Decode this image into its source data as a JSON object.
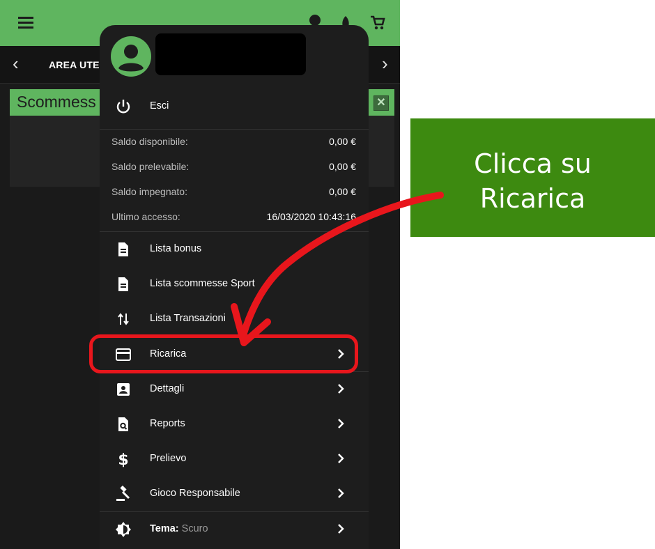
{
  "app": {
    "area_tab": "AREA UTE",
    "panel_title": "Scommess",
    "panel_close": "✕"
  },
  "menu": {
    "logout_label": "Esci",
    "balances": [
      {
        "label": "Saldo disponibile:",
        "value": "0,00 €"
      },
      {
        "label": "Saldo prelevabile:",
        "value": "0,00 €"
      },
      {
        "label": "Saldo impegnato:",
        "value": "0,00 €"
      },
      {
        "label": "Ultimo accesso:",
        "value": "16/03/2020 10:43:16"
      }
    ],
    "items": [
      {
        "label": "Lista bonus",
        "icon": "document-icon"
      },
      {
        "label": "Lista scommesse Sport",
        "icon": "document-icon"
      },
      {
        "label": "Lista Transazioni",
        "icon": "swap-vertical-icon"
      },
      {
        "label": "Ricarica",
        "icon": "credit-card-icon"
      },
      {
        "label": "Dettagli",
        "icon": "contact-card-icon"
      },
      {
        "label": "Reports",
        "icon": "search-document-icon"
      },
      {
        "label": "Prelievo",
        "icon": "dollar-icon"
      },
      {
        "label": "Gioco Responsabile",
        "icon": "gavel-icon"
      }
    ],
    "theme": {
      "label": "Tema:",
      "value": "Scuro",
      "icon": "brightness-icon"
    }
  },
  "annotation": {
    "callout_text": "Clicca su\nRicarica",
    "highlight_color": "#e8161c",
    "callout_color": "#3d8a10"
  },
  "colors": {
    "brand_green": "#5fb55f",
    "menu_bg": "#1d1d1d"
  }
}
